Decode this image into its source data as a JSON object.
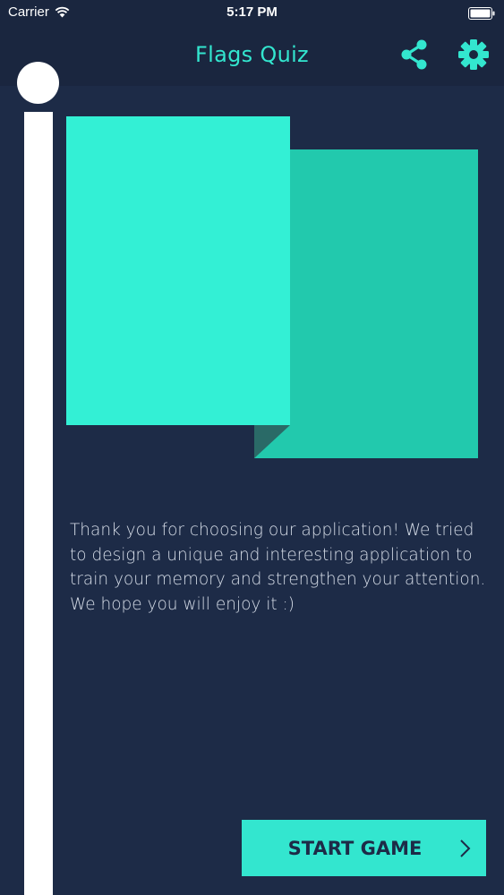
{
  "status_bar": {
    "carrier": "Carrier",
    "time": "5:17 PM"
  },
  "header": {
    "title": "Flags Quiz",
    "share_icon": "share-icon",
    "settings_icon": "gear-icon"
  },
  "main": {
    "description": "Thank you for choosing our application! We tried to design a unique and interesting application to train your memory and strengthen your attention. We hope you will enjoy it :)",
    "start_button_label": "START GAME",
    "start_button_icon": "chevron-right-icon"
  },
  "colors": {
    "background": "#1d2b47",
    "bar_background": "#1a263f",
    "accent": "#33e6cf",
    "flag_front": "#33f0d5",
    "flag_back": "#22c9ad",
    "text": "#d6dde8"
  }
}
